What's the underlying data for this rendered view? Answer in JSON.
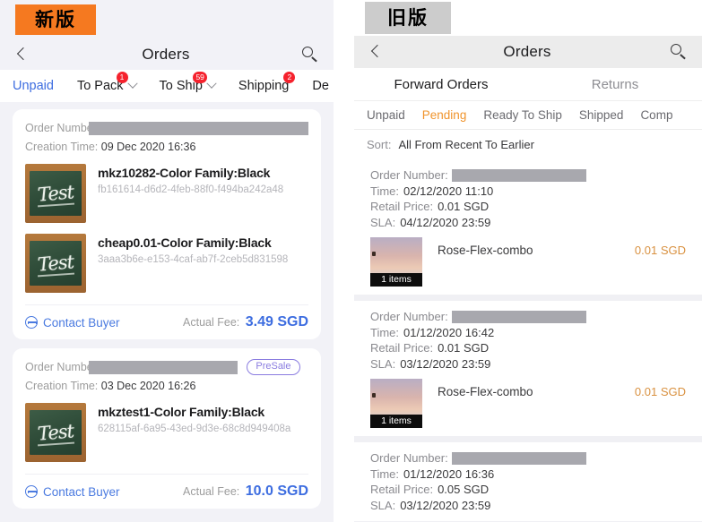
{
  "left": {
    "version_tag": "新版",
    "navbar": {
      "title": "Orders",
      "back_icon": "chevron-left-icon",
      "search_icon": "search-icon"
    },
    "tabs": [
      {
        "label": "Unpaid",
        "badge": "",
        "chevron": false,
        "active": true
      },
      {
        "label": "To Pack",
        "badge": "1",
        "chevron": true,
        "active": false
      },
      {
        "label": "To Ship",
        "badge": "59",
        "chevron": true,
        "active": false
      },
      {
        "label": "Shipping",
        "badge": "2",
        "chevron": false,
        "active": false
      },
      {
        "label": "De",
        "badge": "",
        "chevron": false,
        "active": false
      }
    ],
    "cards": [
      {
        "order_number_label": "Order Number:",
        "order_number_value": "",
        "creation_label": "Creation Time:",
        "creation_value": "09 Dec 2020 16:36",
        "presale": "",
        "items": [
          {
            "name": "mkz10282-Color Family:Black",
            "sku": "fb161614-d6d2-4feb-88f0-f494ba242a48",
            "thumb_caption": "Test"
          },
          {
            "name": "cheap0.01-Color Family:Black",
            "sku": "3aaa3b6e-e153-4caf-ab7f-2ceb5d831598",
            "thumb_caption": "Test"
          }
        ],
        "contact_label": "Contact Buyer",
        "fee_label": "Actual Fee:",
        "fee_value": "3.49 SGD"
      },
      {
        "order_number_label": "Order Number:",
        "order_number_value": "",
        "creation_label": "Creation Time:",
        "creation_value": "03 Dec 2020 16:26",
        "presale": "PreSale",
        "items": [
          {
            "name": "mkztest1-Color Family:Black",
            "sku": "628115af-6a95-43ed-9d3e-68c8d949408a",
            "thumb_caption": "Test"
          }
        ],
        "contact_label": "Contact Buyer",
        "fee_label": "Actual Fee:",
        "fee_value": "10.0 SGD"
      }
    ]
  },
  "right": {
    "version_tag": "旧版",
    "navbar": {
      "title": "Orders",
      "back_icon": "chevron-left-icon",
      "search_icon": "search-icon"
    },
    "segments": [
      {
        "label": "Forward Orders",
        "active": true
      },
      {
        "label": "Returns",
        "active": false
      }
    ],
    "tabs": [
      {
        "label": "Unpaid",
        "active": false
      },
      {
        "label": "Pending",
        "active": true
      },
      {
        "label": "Ready To Ship",
        "active": false
      },
      {
        "label": "Shipped",
        "active": false
      },
      {
        "label": "Comp",
        "active": false
      }
    ],
    "sort": {
      "label": "Sort:",
      "value": "All From Recent To Earlier"
    },
    "cards": [
      {
        "order_number_label": "Order Number:",
        "order_number_value": "",
        "time_label": "Time:",
        "time_value": "02/12/2020 11:10",
        "retail_label": "Retail Price:",
        "retail_value": "0.01 SGD",
        "sla_label": "SLA:",
        "sla_value": "04/12/2020 23:59",
        "item_name": "Rose-Flex-combo",
        "item_price": "0.01 SGD",
        "item_count": "1 items"
      },
      {
        "order_number_label": "Order Number:",
        "order_number_value": "",
        "time_label": "Time:",
        "time_value": "01/12/2020 16:42",
        "retail_label": "Retail Price:",
        "retail_value": "0.01 SGD",
        "sla_label": "SLA:",
        "sla_value": "03/12/2020 23:59",
        "item_name": "Rose-Flex-combo",
        "item_price": "0.01 SGD",
        "item_count": "1 items"
      },
      {
        "order_number_label": "Order Number:",
        "order_number_value": "",
        "time_label": "Time:",
        "time_value": "01/12/2020 16:36",
        "retail_label": "Retail Price:",
        "retail_value": "0.05 SGD",
        "sla_label": "SLA:",
        "sla_value": "03/12/2020 23:59",
        "item_name": "",
        "item_price": "",
        "item_count": ""
      }
    ]
  },
  "colors": {
    "new_tag_bg": "#f57920",
    "old_tag_bg": "#cccccc",
    "badge_red": "#f5222d",
    "link_blue": "#3d6de0",
    "accent_orange": "#f0942c",
    "presale_purple": "#8a7ce0",
    "price_orange": "#d99140"
  }
}
